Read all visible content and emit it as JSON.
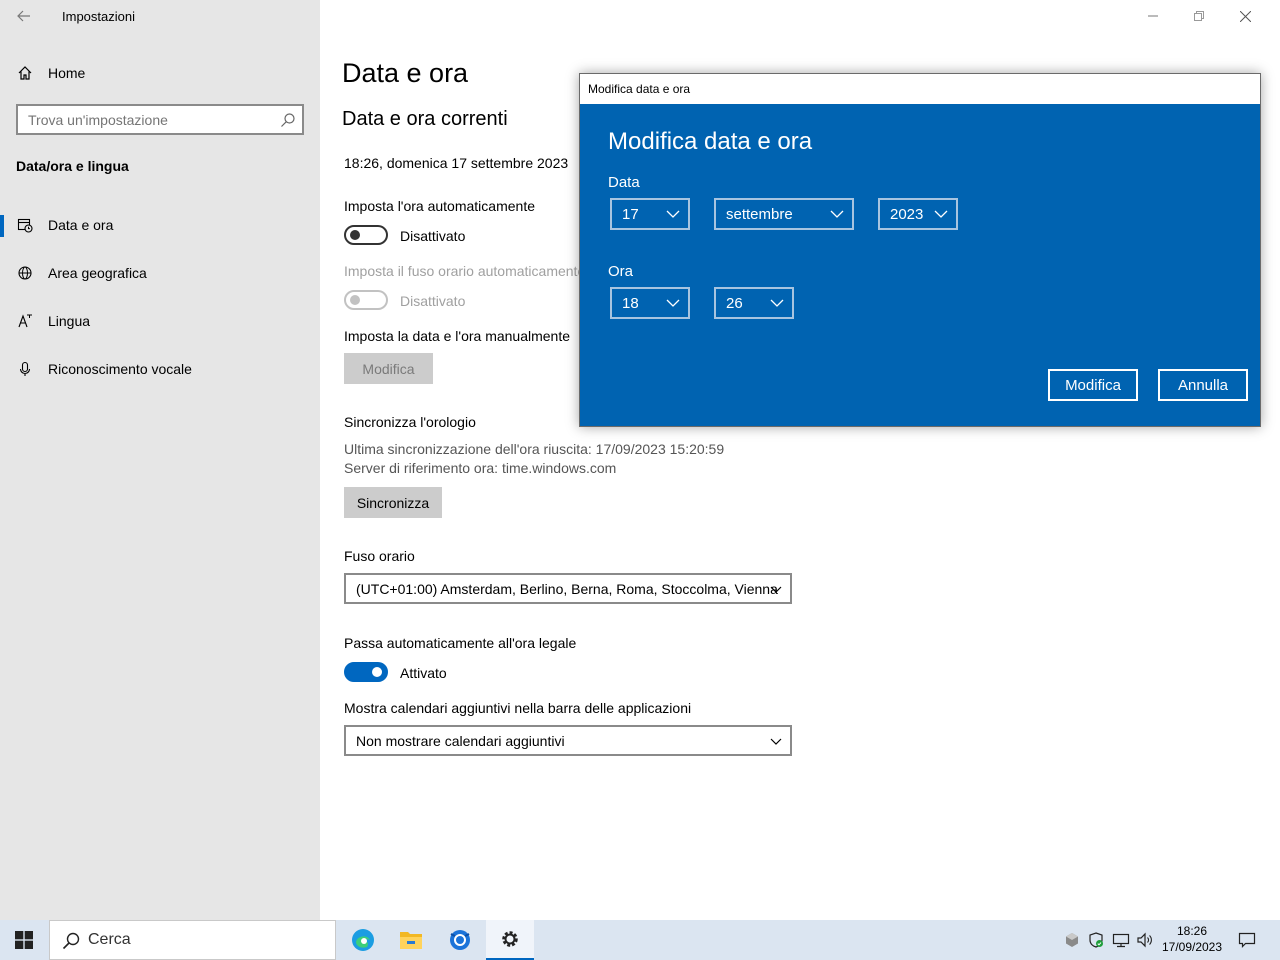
{
  "window": {
    "title": "Impostazioni"
  },
  "sidebar": {
    "home_label": "Home",
    "search_placeholder": "Trova un'impostazione",
    "section": "Data/ora e lingua",
    "items": [
      {
        "label": "Data e ora",
        "icon": "calendar-clock-icon"
      },
      {
        "label": "Area geografica",
        "icon": "globe-icon"
      },
      {
        "label": "Lingua",
        "icon": "language-icon"
      },
      {
        "label": "Riconoscimento vocale",
        "icon": "microphone-icon"
      }
    ]
  },
  "main": {
    "title": "Data e ora",
    "current_heading": "Data e ora correnti",
    "current_value": "18:26, domenica 17 settembre 2023",
    "auto_time_label": "Imposta l'ora automaticamente",
    "auto_time_state": "Disattivato",
    "auto_tz_label": "Imposta il fuso orario automaticamente",
    "auto_tz_state": "Disattivato",
    "manual_label": "Imposta la data e l'ora manualmente",
    "manual_button": "Modifica",
    "sync_heading": "Sincronizza l'orologio",
    "sync_last": "Ultima sincronizzazione dell'ora riuscita: 17/09/2023 15:20:59",
    "sync_server": "Server di riferimento ora: time.windows.com",
    "sync_button": "Sincronizza",
    "tz_label": "Fuso orario",
    "tz_value": "(UTC+01:00) Amsterdam, Berlino, Berna, Roma, Stoccolma, Vienna",
    "dst_label": "Passa automaticamente all'ora legale",
    "dst_state": "Attivato",
    "calendars_label": "Mostra calendari aggiuntivi nella barra delle applicazioni",
    "calendars_value": "Non mostrare calendari aggiuntivi"
  },
  "dialog": {
    "title": "Modifica data e ora",
    "heading": "Modifica data e ora",
    "date_label": "Data",
    "day": "17",
    "month": "settembre",
    "year": "2023",
    "time_label": "Ora",
    "hour": "18",
    "minute": "26",
    "ok_label": "Modifica",
    "cancel_label": "Annulla"
  },
  "taskbar": {
    "search_placeholder": "Cerca",
    "apps": [
      "edge-icon",
      "file-explorer-icon",
      "app-icon",
      "settings-icon"
    ],
    "time": "18:26",
    "date": "17/09/2023"
  },
  "colors": {
    "accent": "#0067c0",
    "dialog_bg": "#0063b1",
    "sidebar_bg": "#e6e6e6"
  }
}
